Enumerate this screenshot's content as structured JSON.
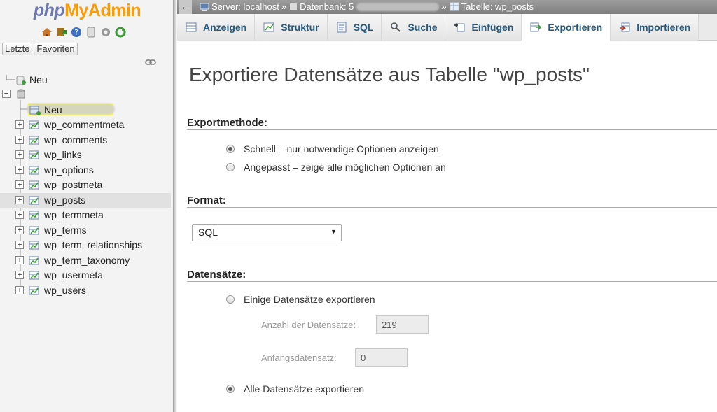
{
  "app": {
    "logo": {
      "part1": "php",
      "part2": "MyAdmin"
    },
    "quick_icons": [
      "home-icon",
      "exit-icon",
      "help-icon",
      "docs-icon",
      "settings-icon",
      "reload-icon"
    ],
    "recent_label": "Letzte",
    "favorites_label": "Favoriten"
  },
  "tree": {
    "new_label": "Neu",
    "database_name": "",
    "db_new_label": "Neu",
    "tables": [
      "wp_commentmeta",
      "wp_comments",
      "wp_links",
      "wp_options",
      "wp_postmeta",
      "wp_posts",
      "wp_termmeta",
      "wp_terms",
      "wp_term_relationships",
      "wp_term_taxonomy",
      "wp_usermeta",
      "wp_users"
    ],
    "selected_table": "wp_posts"
  },
  "breadcrumb": {
    "server": "Server: localhost",
    "database_label": "Datenbank: 5",
    "table": "Tabelle: wp_posts",
    "separator": "»"
  },
  "tabs": [
    {
      "label": "Anzeigen",
      "icon": "browse-icon"
    },
    {
      "label": "Struktur",
      "icon": "structure-icon"
    },
    {
      "label": "SQL",
      "icon": "sql-icon"
    },
    {
      "label": "Suche",
      "icon": "search-icon"
    },
    {
      "label": "Einfügen",
      "icon": "insert-icon"
    },
    {
      "label": "Exportieren",
      "icon": "export-icon",
      "active": true
    },
    {
      "label": "Importieren",
      "icon": "import-icon"
    }
  ],
  "main": {
    "title": "Exportiere Datensätze aus Tabelle \"wp_posts\"",
    "export_method": {
      "heading": "Exportmethode:",
      "quick": "Schnell – nur notwendige Optionen anzeigen",
      "custom": "Angepasst – zeige alle möglichen Optionen an",
      "selected": "quick"
    },
    "format": {
      "heading": "Format:",
      "value": "SQL"
    },
    "rows": {
      "heading": "Datensätze:",
      "some": "Einige Datensätze exportieren",
      "count_label": "Anzahl der Datensätze:",
      "count_value": "219",
      "start_label": "Anfangsdatensatz:",
      "start_value": "0",
      "all": "Alle Datensätze exportieren",
      "selected": "all"
    }
  },
  "colors": {
    "tab_text": "#235a81",
    "logo_php": "#6c78af",
    "logo_myadmin": "#f89c0e",
    "topbar": "#8a8a8a"
  }
}
